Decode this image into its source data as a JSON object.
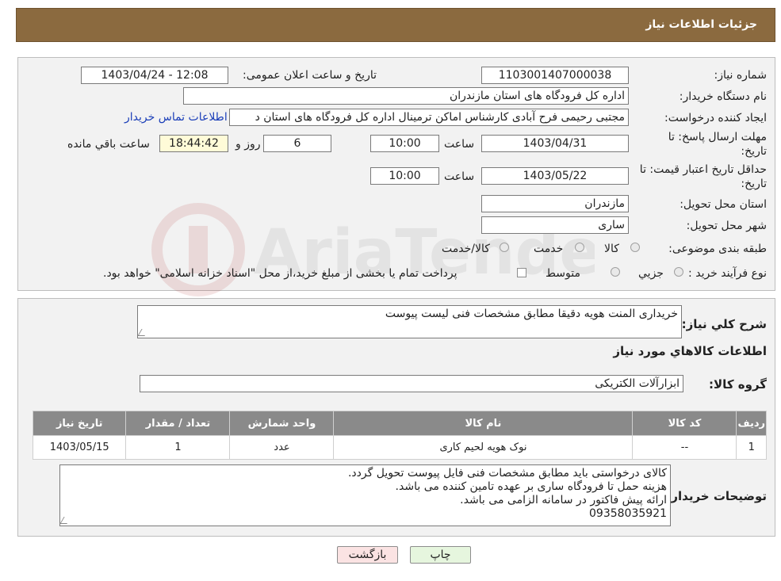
{
  "window": {
    "title": "جزئیات اطلاعات نیاز"
  },
  "watermark": {
    "text": "AriaTender.neT"
  },
  "form": {
    "need_number_label": "شماره نیاز:",
    "need_number": "1103001407000038",
    "announce_label": "تاریخ و ساعت اعلان عمومی:",
    "announce_value": "1403/04/24 - 12:08",
    "buyer_org_label": "نام دستگاه خریدار:",
    "buyer_org": "اداره کل فرودگاه های استان مازندران",
    "creator_label": "ایجاد کننده درخواست:",
    "creator": "مجتبی رحیمی فرح آبادی کارشناس اماکن ترمینال اداره کل فرودگاه های استان د",
    "contact_link": "اطلاعات تماس خریدار",
    "deadline_label_1": "مهلت ارسال پاسخ: تا",
    "deadline_label_2": "تاریخ:",
    "deadline_date": "1403/04/31",
    "time_label": "ساعت",
    "deadline_time": "10:00",
    "days": "6",
    "days_label": "روز و",
    "remaining": "18:44:42",
    "remaining_label": "ساعت باقي مانده",
    "validity_label_1": "حداقل تاریخ اعتبار قیمت: تا",
    "validity_label_2": "تاریخ:",
    "validity_date": "1403/05/22",
    "validity_time": "10:00",
    "province_label": "استان محل تحویل:",
    "province": "مازندران",
    "city_label": "شهر محل تحویل:",
    "city": "ساری",
    "category_label": "طبقه بندی موضوعی:",
    "category_options": [
      "کالا",
      "خدمت",
      "کالا/خدمت"
    ],
    "process_label": "نوع فرآیند خرید :",
    "process_options": [
      "جزیي",
      "متوسط"
    ],
    "payment_note": "پرداخت تمام یا بخشی از مبلغ خرید،از محل \"اسناد خزانه اسلامی\" خواهد بود."
  },
  "details": {
    "summary_label": "شرح کلي نياز:",
    "summary": "خریداری المنت هویه دقیقا مطابق مشخصات فنی لیست پیوست",
    "goods_info_title": "اطلاعات کالاهاي مورد نياز",
    "goods_group_label": "گروه کالا:",
    "goods_group": "ابزارآلات الکتریکی",
    "table": {
      "headers": [
        "رديف",
        "کد کالا",
        "نام کالا",
        "واحد شمارش",
        "تعداد / مقدار",
        "تاريخ نياز"
      ],
      "rows": [
        [
          "1",
          "--",
          "نوک هویه لحیم کاری",
          "عدد",
          "1",
          "1403/05/15"
        ]
      ]
    },
    "buyer_notes_label": "توضيحات خريدار:",
    "buyer_notes": [
      "کالای درخواستی باید مطابق مشخصات فنی فایل پیوست تحویل گردد.",
      "هزینه حمل تا فرودگاه ساری بر عهده تامین کننده می باشد.",
      "ارائه پیش فاکتور در سامانه الزامی می باشد.",
      "09358035921"
    ]
  },
  "buttons": {
    "print": "چاپ",
    "back": "بازگشت"
  }
}
